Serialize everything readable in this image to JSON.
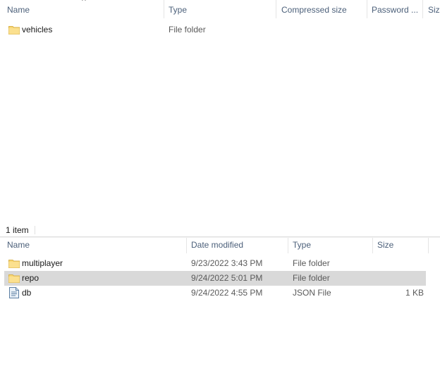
{
  "top_pane": {
    "columns": [
      "Name",
      "Type",
      "Compressed size",
      "Password ...",
      "Size"
    ],
    "sort_indicator": "^",
    "items": [
      {
        "name": "vehicles",
        "icon": "folder-icon",
        "type": "File folder"
      }
    ],
    "status": "1 item"
  },
  "bottom_pane": {
    "columns": [
      "Name",
      "Date modified",
      "Type",
      "Size"
    ],
    "items": [
      {
        "name": "multiplayer",
        "icon": "folder-icon",
        "date": "9/23/2022 3:43 PM",
        "type": "File folder",
        "size": ""
      },
      {
        "name": "repo",
        "icon": "folder-icon",
        "date": "9/24/2022 5:01 PM",
        "type": "File folder",
        "size": "",
        "selected": true
      },
      {
        "name": "db",
        "icon": "json-file-icon",
        "date": "9/24/2022 4:55 PM",
        "type": "JSON File",
        "size": "1 KB"
      }
    ]
  },
  "colors": {
    "header_text": "#4c607a",
    "selection": "#d9d9d9",
    "folder": "#f8d775"
  }
}
